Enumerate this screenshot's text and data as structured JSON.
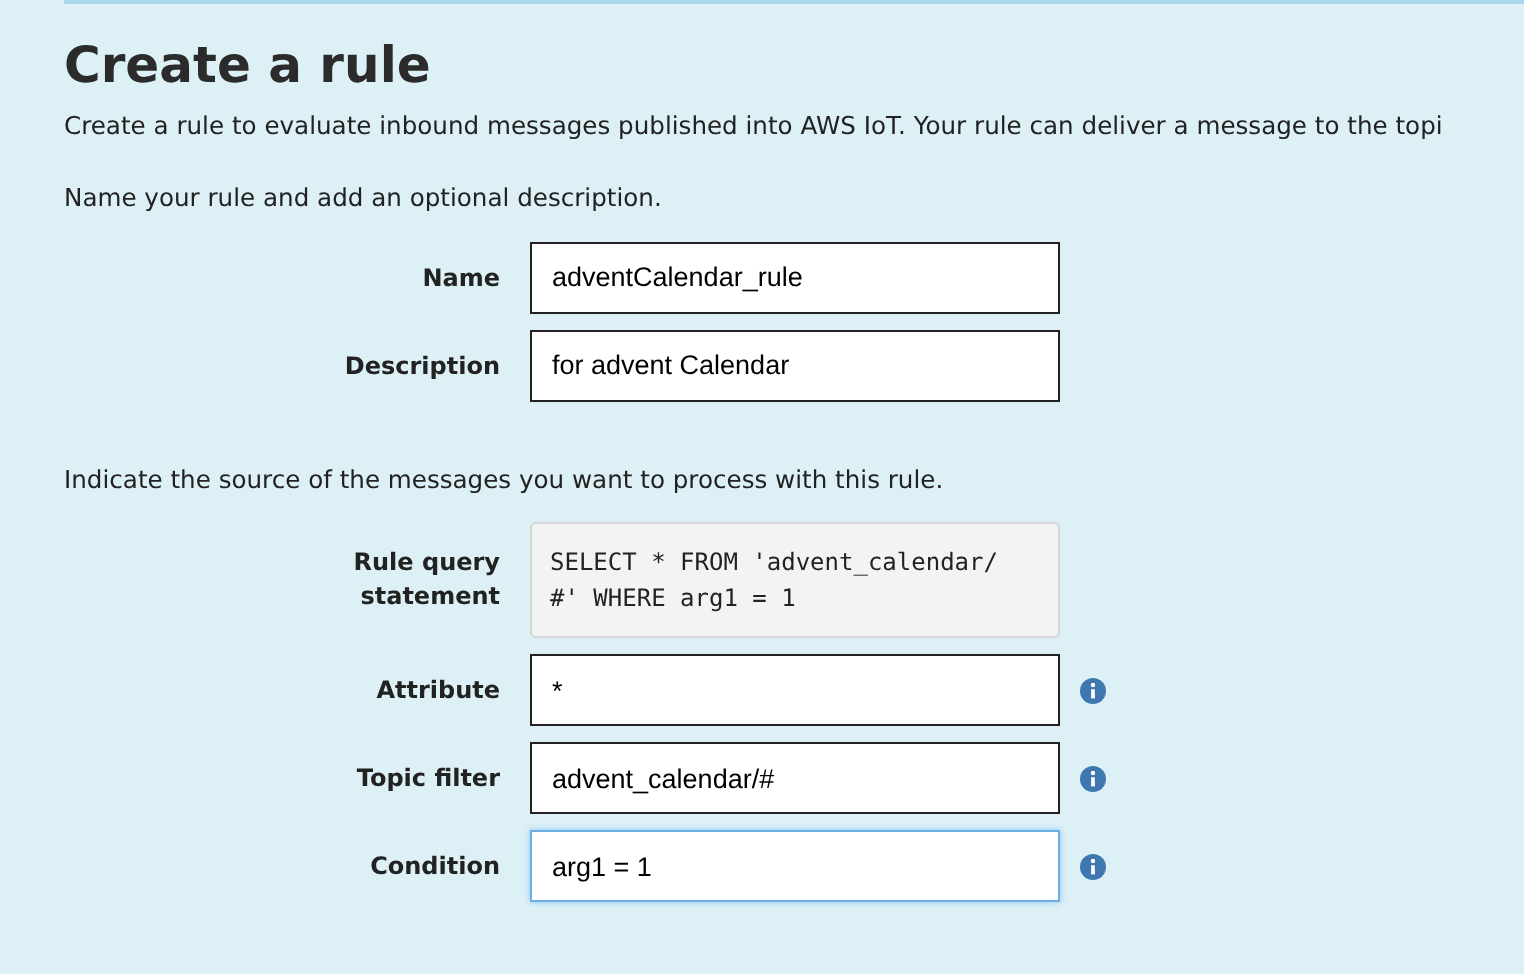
{
  "title": "Create a rule",
  "intro": "Create a rule to evaluate inbound messages published into AWS IoT. Your rule can deliver a message to the topi",
  "sections": [
    {
      "text": "Name your rule and add an optional description.",
      "fields": [
        {
          "kind": "input",
          "label": "Name",
          "value": "adventCalendar_rule",
          "info": false,
          "focused": false
        },
        {
          "kind": "input",
          "label": "Description",
          "value": "for advent Calendar",
          "info": false,
          "focused": false
        }
      ]
    },
    {
      "text": "Indicate the source of the messages you want to process with this rule.",
      "fields": [
        {
          "kind": "query",
          "label": "Rule query statement",
          "value": "SELECT * FROM 'advent_calendar/ #' WHERE arg1 = 1",
          "info": false
        },
        {
          "kind": "input",
          "label": "Attribute",
          "value": "*",
          "info": true,
          "focused": false
        },
        {
          "kind": "input",
          "label": "Topic filter",
          "value": "advent_calendar/#",
          "info": true,
          "focused": false
        },
        {
          "kind": "input",
          "label": "Condition",
          "value": "arg1 = 1",
          "info": true,
          "focused": true
        }
      ]
    }
  ]
}
